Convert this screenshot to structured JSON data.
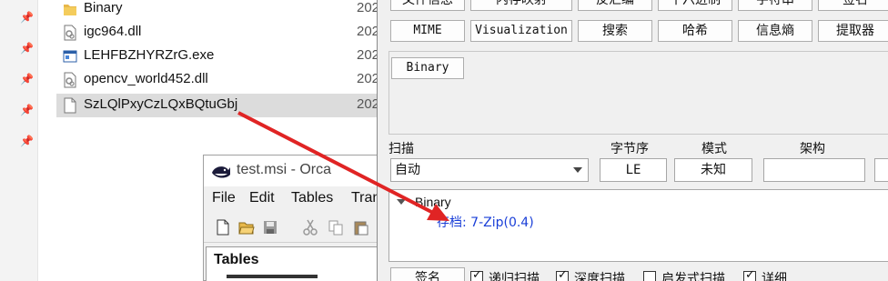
{
  "explorer": {
    "files": [
      {
        "name": "Binary",
        "date": "202",
        "icon": "folder-icon"
      },
      {
        "name": "igc964.dll",
        "date": "202",
        "icon": "dll-file-icon"
      },
      {
        "name": "LEHFBZHYRZrG.exe",
        "date": "202",
        "icon": "exe-file-icon"
      },
      {
        "name": "opencv_world452.dll",
        "date": "202",
        "icon": "dll-file-icon"
      },
      {
        "name": "SzLQlPxyCzLQxBQtuGbj",
        "date": "202",
        "icon": "blank-file-icon"
      }
    ]
  },
  "orca": {
    "title": "test.msi - Orca",
    "menu": [
      "File",
      "Edit",
      "Tables",
      "Tran"
    ],
    "tables_header": "Tables"
  },
  "die": {
    "top_buttons_row1": [
      "文件信息",
      "内存映射",
      "反汇编",
      "十六进制",
      "字符串",
      "签名"
    ],
    "top_buttons_row2": [
      "MIME",
      "Visualization",
      "搜索",
      "哈希",
      "信息熵",
      "提取器"
    ],
    "binary_button": "Binary",
    "scan_label": "扫描",
    "scan_value": "自动",
    "endian_label": "字节序",
    "endian_value": "LE",
    "mode_label": "模式",
    "mode_value": "未知",
    "arch_label": "架构",
    "arch_value": "",
    "result_root": "Binary",
    "result_child": "存档: 7-Zip(0.4)",
    "bottom_button": "签名",
    "options": [
      {
        "label": "递归扫描",
        "checked": true
      },
      {
        "label": "深度扫描",
        "checked": true
      },
      {
        "label": "启发式扫描",
        "checked": false
      },
      {
        "label": "详细",
        "checked": true
      }
    ]
  },
  "colors": {
    "arrow": "#e02424",
    "link_blue": "#1a3fd8",
    "selection": "#dcdcdc"
  }
}
